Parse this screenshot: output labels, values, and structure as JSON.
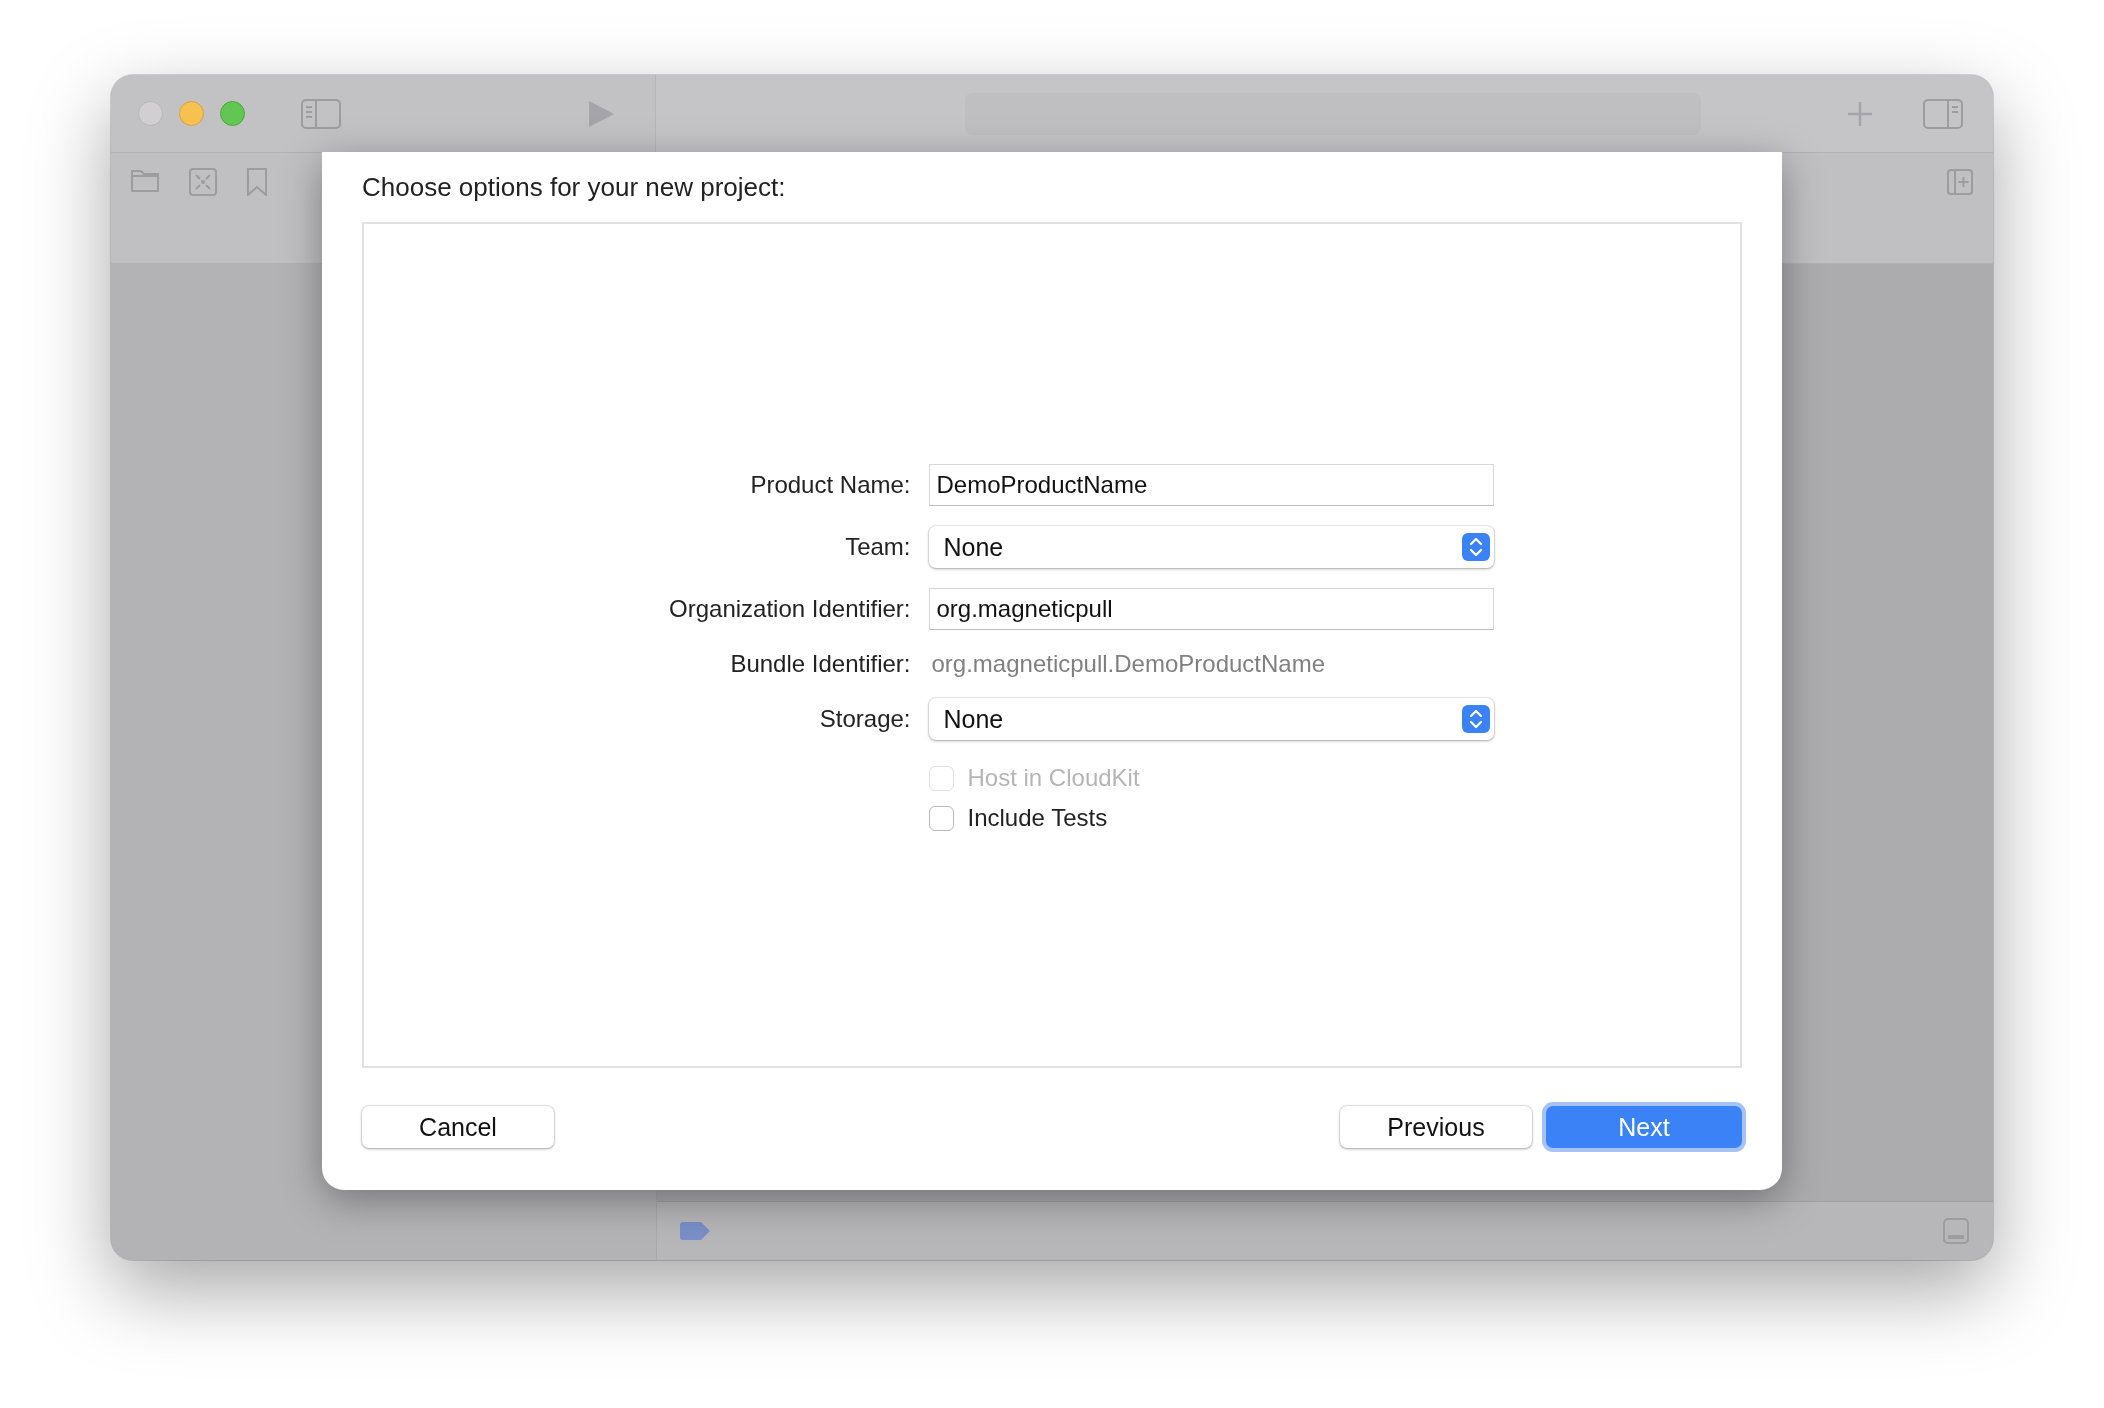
{
  "dialog": {
    "title": "Choose options for your new project:",
    "fields": [
      {
        "kind": "text",
        "label": "Product Name:",
        "value": "DemoProductName"
      },
      {
        "kind": "popup",
        "label": "Team:",
        "value": "None"
      },
      {
        "kind": "text",
        "label": "Organization Identifier:",
        "value": "org.magneticpull"
      },
      {
        "kind": "readonly",
        "label": "Bundle Identifier:",
        "value": "org.magneticpull.DemoProductName"
      },
      {
        "kind": "popup",
        "label": "Storage:",
        "value": "None"
      }
    ],
    "checkboxes": [
      {
        "label": "Host in CloudKit",
        "checked": false,
        "disabled": true
      },
      {
        "label": "Include Tests",
        "checked": false,
        "disabled": false
      }
    ],
    "buttons": [
      {
        "label": "Cancel",
        "kind": "normal"
      },
      {
        "label": "Previous",
        "kind": "normal"
      },
      {
        "label": "Next",
        "kind": "default"
      }
    ]
  }
}
